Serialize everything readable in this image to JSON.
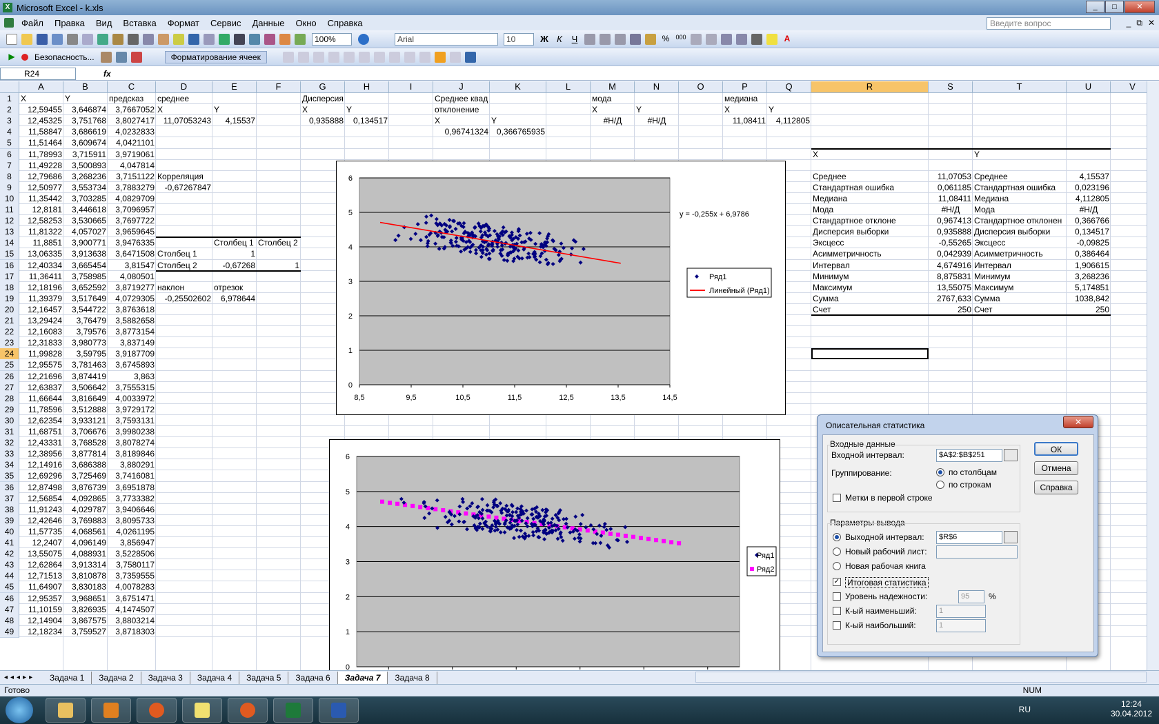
{
  "window": {
    "title": "Microsoft Excel - k.xls",
    "min": "_",
    "max": "□",
    "close": "✕"
  },
  "menu": [
    "Файл",
    "Правка",
    "Вид",
    "Вставка",
    "Формат",
    "Сервис",
    "Данные",
    "Окно",
    "Справка"
  ],
  "help_placeholder": "Введите вопрос",
  "toolbar": {
    "zoom": "100%",
    "font": "Arial",
    "size": "10",
    "security": "Безопасность...",
    "format_cells": "Форматирование ячеек"
  },
  "namebox": "R24",
  "fx": "fx",
  "columns": [
    {
      "name": "A",
      "w": 64
    },
    {
      "name": "B",
      "w": 64
    },
    {
      "name": "C",
      "w": 70
    },
    {
      "name": "D",
      "w": 82
    },
    {
      "name": "E",
      "w": 64
    },
    {
      "name": "F",
      "w": 64
    },
    {
      "name": "G",
      "w": 64
    },
    {
      "name": "H",
      "w": 64
    },
    {
      "name": "I",
      "w": 64
    },
    {
      "name": "J",
      "w": 82
    },
    {
      "name": "K",
      "w": 82
    },
    {
      "name": "L",
      "w": 64
    },
    {
      "name": "M",
      "w": 64
    },
    {
      "name": "N",
      "w": 64
    },
    {
      "name": "O",
      "w": 64
    },
    {
      "name": "P",
      "w": 64
    },
    {
      "name": "Q",
      "w": 64
    },
    {
      "name": "R",
      "w": 170
    },
    {
      "name": "S",
      "w": 64
    },
    {
      "name": "T",
      "w": 136
    },
    {
      "name": "U",
      "w": 64
    },
    {
      "name": "V",
      "w": 64
    }
  ],
  "selected_col": "R",
  "selected_row": 24,
  "rows": [
    {
      "A": "X",
      "B": "Y",
      "C": "предсказ",
      "D": "среднее",
      "G": "Дисперсия",
      "J": "Среднее квадратическое",
      "M": "мода",
      "P": "медиана"
    },
    {
      "A": "12,59455",
      "B": "3,646874",
      "C": "3,7667052",
      "D": "X",
      "E": "Y",
      "G": "X",
      "H": "Y",
      "J": "отклонение",
      "M": "X",
      "N": "Y",
      "P": "X",
      "Q": "Y"
    },
    {
      "A": "12,45325",
      "B": "3,751768",
      "C": "3,8027417",
      "D": "11,07053243",
      "E": "4,15537",
      "G": "0,935888",
      "H": "0,134517",
      "J": "X",
      "K": "Y",
      "M": "#Н/Д",
      "N": "#Н/Д",
      "P": "11,08411",
      "Q": "4,112805"
    },
    {
      "A": "11,58847",
      "B": "3,686619",
      "C": "4,0232833",
      "J": "0,96741324",
      "K": "0,366765935"
    },
    {
      "A": "11,51464",
      "B": "3,609674",
      "C": "4,0421101"
    },
    {
      "A": "11,78993",
      "B": "3,715911",
      "C": "3,9719061",
      "R": "X",
      "T": "Y"
    },
    {
      "A": "11,49228",
      "B": "3,500893",
      "C": "4,047814"
    },
    {
      "A": "12,79686",
      "B": "3,268236",
      "C": "3,7151122",
      "D": "Корреляция",
      "R": "Среднее",
      "S": "11,07053",
      "T": "Среднее",
      "U": "4,15537"
    },
    {
      "A": "12,50977",
      "B": "3,553734",
      "C": "3,7883279",
      "D": "-0,67267847",
      "R": "Стандартная ошибка",
      "S": "0,061185",
      "T": "Стандартная ошибка",
      "U": "0,023196"
    },
    {
      "A": "11,35442",
      "B": "3,703285",
      "C": "4,0829709",
      "R": "Медиана",
      "S": "11,08411",
      "T": "Медиана",
      "U": "4,112805"
    },
    {
      "A": "12,8181",
      "B": "3,446618",
      "C": "3,7096957",
      "R": "Мода",
      "S": "#Н/Д",
      "T": "Мода",
      "U": "#Н/Д"
    },
    {
      "A": "12,58253",
      "B": "3,530665",
      "C": "3,7697722",
      "R": "Стандартное отклоне",
      "S": "0,967413",
      "T": "Стандартное отклонен",
      "U": "0,366766"
    },
    {
      "A": "11,81322",
      "B": "4,057027",
      "C": "3,9659645",
      "R": "Дисперсия выборки",
      "S": "0,935888",
      "T": "Дисперсия выборки",
      "U": "0,134517"
    },
    {
      "A": "11,8851",
      "B": "3,900771",
      "C": "3,9476335",
      "E": "Столбец 1",
      "F": "Столбец 2",
      "R": "Эксцесс",
      "S": "-0,55265",
      "T": "Эксцесс",
      "U": "-0,09825"
    },
    {
      "A": "13,06335",
      "B": "3,913638",
      "C": "3,6471508",
      "D": "Столбец 1",
      "E": "1",
      "R": "Асимметричность",
      "S": "0,042939",
      "T": "Асимметричность",
      "U": "0,386464"
    },
    {
      "A": "12,40334",
      "B": "3,665454",
      "C": "3,81547",
      "D": "Столбец 2",
      "E": "-0,67268",
      "F": "1",
      "R": "Интервал",
      "S": "4,674916",
      "T": "Интервал",
      "U": "1,906615"
    },
    {
      "A": "11,36411",
      "B": "3,758985",
      "C": "4,080501",
      "R": "Минимум",
      "S": "8,875831",
      "T": "Минимум",
      "U": "3,268236"
    },
    {
      "A": "12,18196",
      "B": "3,652592",
      "C": "3,8719277",
      "D": "наклон",
      "E": "отрезок",
      "R": "Максимум",
      "S": "13,55075",
      "T": "Максимум",
      "U": "5,174851"
    },
    {
      "A": "11,39379",
      "B": "3,517649",
      "C": "4,0729305",
      "D": "-0,25502602",
      "E": "6,978644",
      "R": "Сумма",
      "S": "2767,633",
      "T": "Сумма",
      "U": "1038,842"
    },
    {
      "A": "12,16457",
      "B": "3,544722",
      "C": "3,8763618",
      "R": "Счет",
      "S": "250",
      "T": "Счет",
      "U": "250"
    },
    {
      "A": "13,29424",
      "B": "3,76479",
      "C": "3,5882658"
    },
    {
      "A": "12,16083",
      "B": "3,79576",
      "C": "3,8773154"
    },
    {
      "A": "12,31833",
      "B": "3,980773",
      "C": "3,837149"
    },
    {
      "A": "11,99828",
      "B": "3,59795",
      "C": "3,9187709"
    },
    {
      "A": "12,95575",
      "B": "3,781463",
      "C": "3,6745893"
    },
    {
      "A": "12,21696",
      "B": "3,874419",
      "C": "3,863"
    },
    {
      "A": "12,63837",
      "B": "3,506642",
      "C": "3,7555315"
    },
    {
      "A": "11,66644",
      "B": "3,816649",
      "C": "4,0033972"
    },
    {
      "A": "11,78596",
      "B": "3,512888",
      "C": "3,9729172"
    },
    {
      "A": "12,62354",
      "B": "3,933121",
      "C": "3,7593131"
    },
    {
      "A": "11,68751",
      "B": "3,706676",
      "C": "3,9980238"
    },
    {
      "A": "12,43331",
      "B": "3,768528",
      "C": "3,8078274"
    },
    {
      "A": "12,38956",
      "B": "3,877814",
      "C": "3,8189846"
    },
    {
      "A": "12,14916",
      "B": "3,686388",
      "C": "3,880291"
    },
    {
      "A": "12,69296",
      "B": "3,725469",
      "C": "3,7416081"
    },
    {
      "A": "12,87498",
      "B": "3,876739",
      "C": "3,6951878"
    },
    {
      "A": "12,56854",
      "B": "4,092865",
      "C": "3,7733382"
    },
    {
      "A": "11,91243",
      "B": "4,029787",
      "C": "3,9406646"
    },
    {
      "A": "12,42646",
      "B": "3,769883",
      "C": "3,8095733"
    },
    {
      "A": "11,57735",
      "B": "4,068561",
      "C": "4,0261195"
    },
    {
      "A": "12,2407",
      "B": "4,096149",
      "C": "3,856947"
    },
    {
      "A": "13,55075",
      "B": "4,088931",
      "C": "3,5228506"
    },
    {
      "A": "12,62864",
      "B": "3,913314",
      "C": "3,7580117"
    },
    {
      "A": "12,71513",
      "B": "3,810878",
      "C": "3,7359555"
    },
    {
      "A": "11,64907",
      "B": "3,830183",
      "C": "4,0078283"
    },
    {
      "A": "12,95357",
      "B": "3,968651",
      "C": "3,6751471"
    },
    {
      "A": "11,10159",
      "B": "3,826935",
      "C": "4,1474507"
    },
    {
      "A": "12,14904",
      "B": "3,867575",
      "C": "3,8803214"
    },
    {
      "A": "12,18234",
      "B": "3,759527",
      "C": "3,8718303"
    }
  ],
  "chart_data": [
    {
      "type": "scatter",
      "x_ticks": [
        "8,5",
        "9,5",
        "10,5",
        "11,5",
        "12,5",
        "13,5",
        "14,5"
      ],
      "y_ticks": [
        "0",
        "1",
        "2",
        "3",
        "4",
        "5",
        "6"
      ],
      "xlim": [
        8.5,
        14.5
      ],
      "ylim": [
        0,
        6
      ],
      "trendline_label": "y = -0,255x + 6,9786",
      "legend": [
        "Ряд1",
        "Линейный (Ряд1)"
      ],
      "slope": -0.255,
      "intercept": 6.9786,
      "trend_x": [
        8.9,
        13.55
      ],
      "legend_position": "right"
    },
    {
      "type": "scatter",
      "x_ticks": [],
      "y_ticks": [
        "0",
        "1",
        "2",
        "3",
        "4",
        "5",
        "6"
      ],
      "xlim": [
        8.5,
        14.5
      ],
      "ylim": [
        0,
        6
      ],
      "legend": [
        "Ряд1",
        "Ряд2"
      ],
      "legend_position": "right",
      "series2_x_range": [
        8.9,
        13.55
      ]
    }
  ],
  "dialog": {
    "title": "Описательная статистика",
    "close": "✕",
    "input_group": "Входные данные",
    "input_range_label": "Входной интервал:",
    "input_range": "$A$2:$B$251",
    "grouping_label": "Группирование:",
    "by_columns": "по столбцам",
    "by_rows": "по строкам",
    "labels_first_row": "Метки в первой строке",
    "output_group": "Параметры вывода",
    "output_range_label": "Выходной интервал:",
    "output_range": "$R$6",
    "new_sheet": "Новый рабочий лист:",
    "new_book": "Новая рабочая книга",
    "summary_stats": "Итоговая статистика",
    "confidence": "Уровень надежности:",
    "confidence_val": "95",
    "percent": "%",
    "kth_smallest": "К-ый наименьший:",
    "kth_smallest_val": "1",
    "kth_largest": "К-ый наибольший:",
    "kth_largest_val": "1",
    "ok": "ОК",
    "cancel": "Отмена",
    "help": "Справка"
  },
  "sheets": [
    "Задача 1",
    "Задача 2",
    "Задача 3",
    "Задача 4",
    "Задача 5",
    "Задача 6",
    "Задача 7",
    "Задача 8"
  ],
  "active_sheet": "Задача 7",
  "status": "Готово",
  "num": "NUM",
  "lang": "RU",
  "time": "12:24",
  "date": "30.04.2012"
}
